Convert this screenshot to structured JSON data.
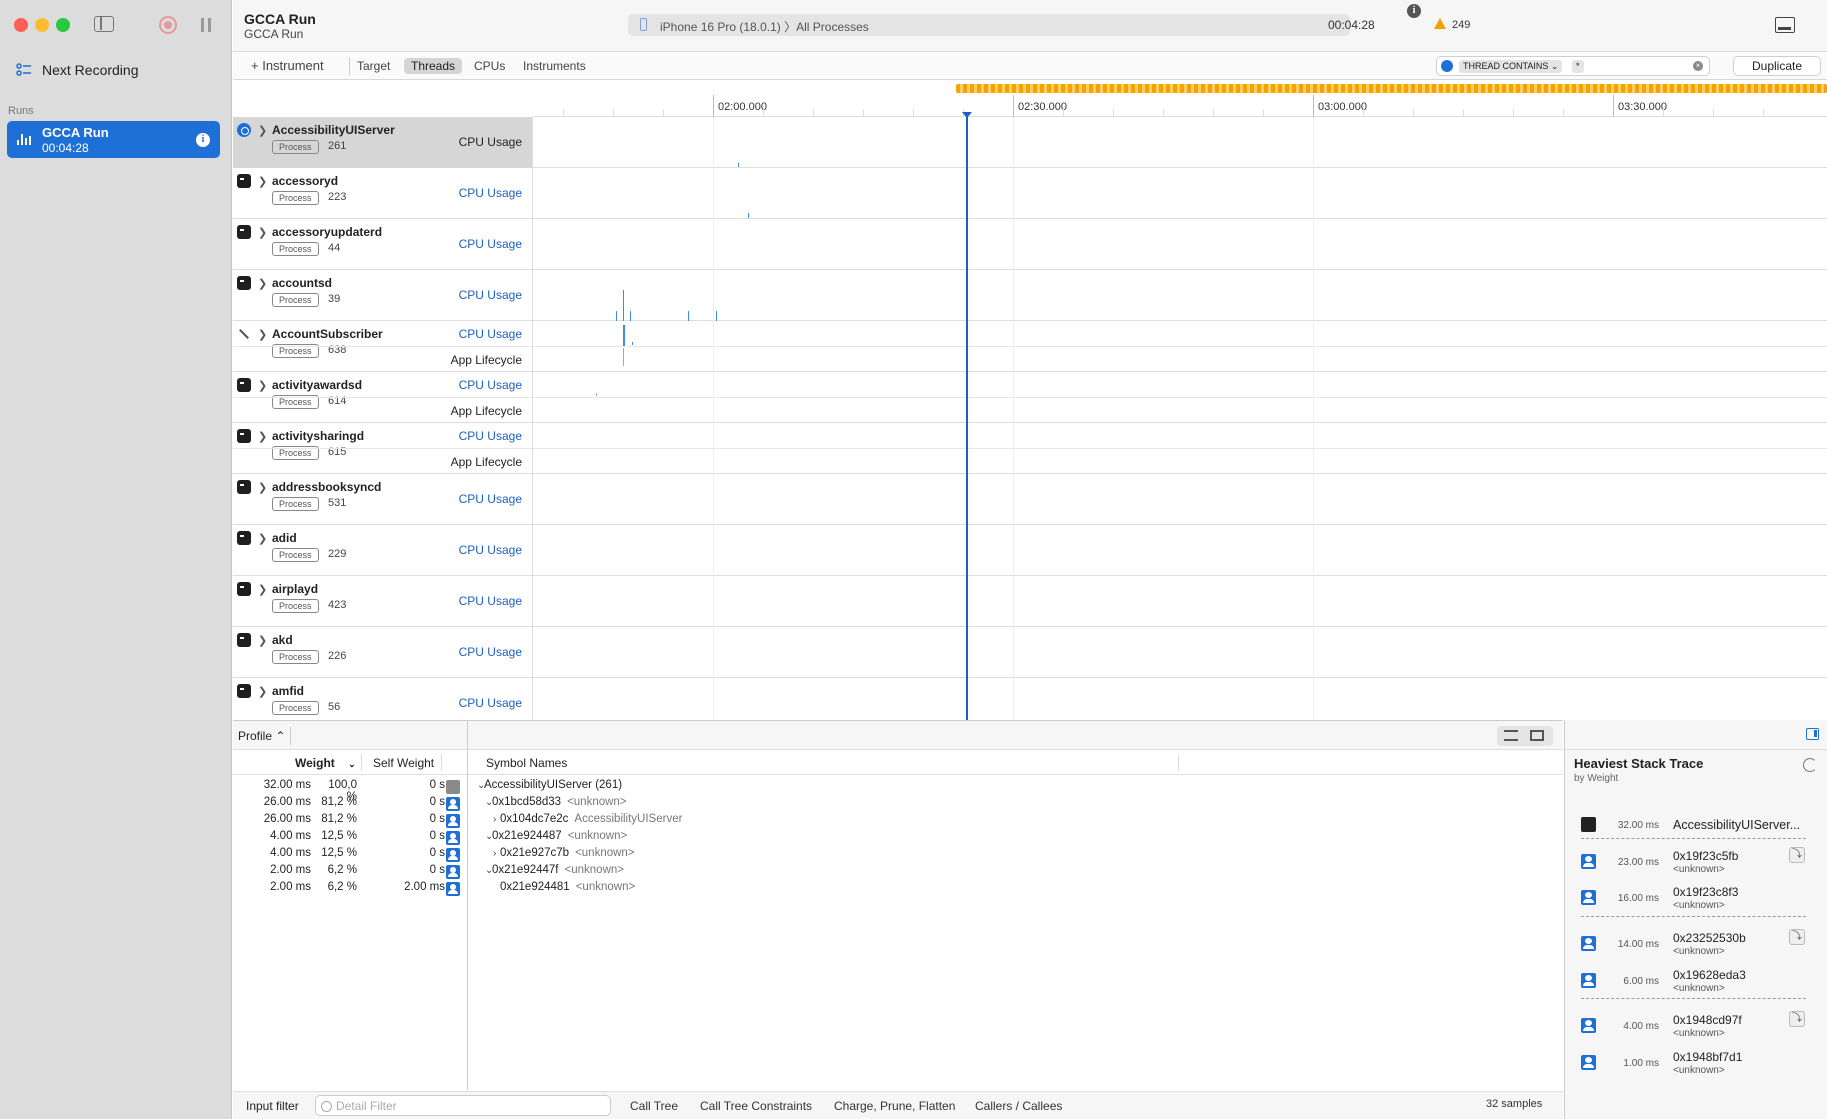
{
  "sidebar": {
    "next_recording": "Next Recording",
    "runs_label": "Runs",
    "run": {
      "name": "GCCA Run",
      "duration": "00:04:28"
    }
  },
  "toolbar": {
    "title": "GCCA Run",
    "subtitle": "GCCA Run",
    "device": "iPhone 16 Pro (18.0.1)",
    "target": "All Processes",
    "elapsed": "00:04:28",
    "warnings": "249"
  },
  "strip": {
    "add_instrument": "+ Instrument",
    "scopes": [
      "Target",
      "Threads",
      "CPUs",
      "Instruments"
    ],
    "selected_scope": "Threads",
    "filter_token": "THREAD CONTAINS ⌄",
    "filter_value": "*",
    "duplicate": "Duplicate"
  },
  "ruler": {
    "ticks": [
      "02:00.000",
      "02:30.000",
      "03:00.000",
      "03:30.000"
    ]
  },
  "tracks": [
    {
      "name": "AccessibilityUIServer",
      "badge": "Process",
      "pid": "261",
      "track": "CPU Usage",
      "icon": "blue",
      "selected": true
    },
    {
      "name": "accessoryd",
      "badge": "Process",
      "pid": "223",
      "track": "CPU Usage",
      "icon": "terminal"
    },
    {
      "name": "accessoryupdaterd",
      "badge": "Process",
      "pid": "44",
      "track": "CPU Usage",
      "icon": "terminal"
    },
    {
      "name": "accountsd",
      "badge": "Process",
      "pid": "39",
      "track": "CPU Usage",
      "icon": "terminal"
    },
    {
      "name": "AccountSubscriber",
      "badge": "Process",
      "pid": "638",
      "track": "CPU Usage",
      "track2": "App Lifecycle",
      "icon": "tool"
    },
    {
      "name": "activityawardsd",
      "badge": "Process",
      "pid": "614",
      "track": "CPU Usage",
      "track2": "App Lifecycle",
      "icon": "terminal"
    },
    {
      "name": "activitysharingd",
      "badge": "Process",
      "pid": "615",
      "track": "CPU Usage",
      "track2": "App Lifecycle",
      "icon": "terminal"
    },
    {
      "name": "addressbooksyncd",
      "badge": "Process",
      "pid": "531",
      "track": "CPU Usage",
      "icon": "terminal"
    },
    {
      "name": "adid",
      "badge": "Process",
      "pid": "229",
      "track": "CPU Usage",
      "icon": "terminal"
    },
    {
      "name": "airplayd",
      "badge": "Process",
      "pid": "423",
      "track": "CPU Usage",
      "icon": "terminal"
    },
    {
      "name": "akd",
      "badge": "Process",
      "pid": "226",
      "track": "CPU Usage",
      "icon": "terminal"
    },
    {
      "name": "amfid",
      "badge": "Process",
      "pid": "56",
      "track": "CPU Usage",
      "icon": "terminal"
    }
  ],
  "detail": {
    "mode": "Profile ⌃",
    "columns": {
      "weight": "Weight",
      "self_weight": "Self Weight",
      "symbol": "Symbol Names"
    },
    "rows": [
      {
        "weight": "32.00 ms",
        "pct": "100,0 %",
        "self": "0 s",
        "symbol": "AccessibilityUIServer (261)",
        "lib": "",
        "depth": 0,
        "disc": "open",
        "icon": "gray"
      },
      {
        "weight": "26.00 ms",
        "pct": "81,2 %",
        "self": "0 s",
        "symbol": "0x1bcd58d33",
        "lib": "<unknown>",
        "depth": 1,
        "disc": "open",
        "icon": "user"
      },
      {
        "weight": "26.00 ms",
        "pct": "81,2 %",
        "self": "0 s",
        "symbol": "0x104dc7e2c",
        "lib": "AccessibilityUIServer",
        "depth": 2,
        "disc": "closed",
        "icon": "user"
      },
      {
        "weight": "4.00 ms",
        "pct": "12,5 %",
        "self": "0 s",
        "symbol": "0x21e924487",
        "lib": "<unknown>",
        "depth": 1,
        "disc": "open",
        "icon": "user"
      },
      {
        "weight": "4.00 ms",
        "pct": "12,5 %",
        "self": "0 s",
        "symbol": "0x21e927c7b",
        "lib": "<unknown>",
        "depth": 2,
        "disc": "closed",
        "icon": "user"
      },
      {
        "weight": "2.00 ms",
        "pct": "6,2 %",
        "self": "0 s",
        "symbol": "0x21e92447f",
        "lib": "<unknown>",
        "depth": 1,
        "disc": "open",
        "icon": "user"
      },
      {
        "weight": "2.00 ms",
        "pct": "6,2 %",
        "self": "2.00 ms",
        "symbol": "0x21e924481",
        "lib": "<unknown>",
        "depth": 2,
        "disc": "none",
        "icon": "user"
      }
    ]
  },
  "statusbar": {
    "input_filter": "Input filter",
    "detail_filter_placeholder": "Detail Filter",
    "buttons": [
      "Call Tree",
      "Call Tree Constraints",
      "Charge, Prune, Flatten",
      "Callers / Callees"
    ],
    "samples": "32 samples"
  },
  "stack": {
    "title": "Heaviest Stack Trace",
    "subtitle": "by Weight",
    "frames": [
      {
        "ms": "32.00 ms",
        "name": "AccessibilityUIServer...",
        "lib": "",
        "icon": "dark"
      },
      {
        "ms": "23.00 ms",
        "name": "0x19f23c5fb",
        "lib": "<unknown>",
        "icon": "user",
        "jump": true
      },
      {
        "ms": "16.00 ms",
        "name": "0x19f23c8f3",
        "lib": "<unknown>",
        "icon": "user"
      },
      {
        "ms": "14.00 ms",
        "name": "0x23252530b",
        "lib": "<unknown>",
        "icon": "user",
        "jump": true
      },
      {
        "ms": "6.00 ms",
        "name": "0x19628eda3",
        "lib": "<unknown>",
        "icon": "user"
      },
      {
        "ms": "4.00 ms",
        "name": "0x1948cd97f",
        "lib": "<unknown>",
        "icon": "user",
        "jump": true
      },
      {
        "ms": "1.00 ms",
        "name": "0x1948bf7d1",
        "lib": "<unknown>",
        "icon": "user"
      }
    ]
  },
  "colors": {
    "accent": "#1e6fd6",
    "warning": "#f0a300",
    "record": "#e89a9a"
  }
}
